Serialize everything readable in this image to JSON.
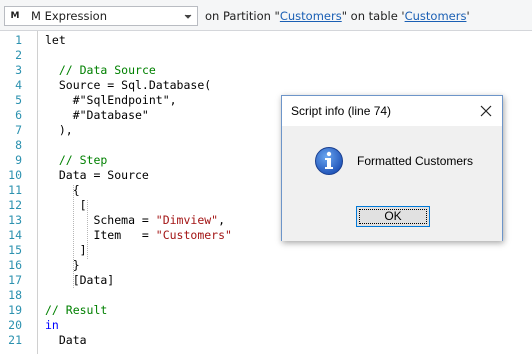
{
  "toolbar": {
    "expression_icon": "M",
    "expression_type": "M Expression",
    "partition_prefix": "on Partition \"",
    "partition_name": "Customers",
    "table_middle": "\" on table '",
    "table_name": "Customers",
    "table_suffix": "'"
  },
  "editor": {
    "lines": [
      {
        "n": "1",
        "parts": [
          [
            "",
            "let"
          ]
        ]
      },
      {
        "n": "2",
        "parts": []
      },
      {
        "n": "3",
        "parts": [
          [
            "",
            "  "
          ],
          [
            "cm",
            "// Data Source"
          ]
        ]
      },
      {
        "n": "4",
        "parts": [
          [
            "",
            "  Source = Sql.Database("
          ]
        ]
      },
      {
        "n": "5",
        "parts": [
          [
            "",
            "    #\"SqlEndpoint\","
          ]
        ]
      },
      {
        "n": "6",
        "parts": [
          [
            "",
            "    #\"Database\""
          ]
        ]
      },
      {
        "n": "7",
        "parts": [
          [
            "",
            "  ),"
          ]
        ]
      },
      {
        "n": "8",
        "parts": []
      },
      {
        "n": "9",
        "parts": [
          [
            "",
            "  "
          ],
          [
            "cm",
            "// Step"
          ]
        ]
      },
      {
        "n": "10",
        "parts": [
          [
            "",
            "  Data = Source"
          ]
        ]
      },
      {
        "n": "11",
        "parts": [
          [
            "",
            "    {"
          ]
        ]
      },
      {
        "n": "12",
        "parts": [
          [
            "",
            "     ["
          ]
        ]
      },
      {
        "n": "13",
        "parts": [
          [
            "",
            "       Schema = "
          ],
          [
            "st",
            "\"Dimview\""
          ],
          [
            "",
            ","
          ]
        ]
      },
      {
        "n": "14",
        "parts": [
          [
            "",
            "       Item   = "
          ],
          [
            "st",
            "\"Customers\""
          ]
        ]
      },
      {
        "n": "15",
        "parts": [
          [
            "",
            "     ]"
          ]
        ]
      },
      {
        "n": "16",
        "parts": [
          [
            "",
            "    }"
          ]
        ]
      },
      {
        "n": "17",
        "parts": [
          [
            "",
            "    [Data]"
          ]
        ]
      },
      {
        "n": "18",
        "parts": []
      },
      {
        "n": "19",
        "parts": [
          [
            "cm",
            "// Result"
          ]
        ]
      },
      {
        "n": "20",
        "parts": [
          [
            "kw",
            "in"
          ]
        ]
      },
      {
        "n": "21",
        "parts": [
          [
            "",
            "  Data"
          ]
        ]
      }
    ]
  },
  "dialog": {
    "title": "Script info (line 74)",
    "message": "Formatted Customers",
    "ok_label": "OK",
    "icon": "info-icon",
    "close_icon": "close-icon"
  },
  "colors": {
    "line_numbers": "#2b91af",
    "comment": "#008000",
    "string": "#a31515",
    "keyword": "#0000ff",
    "link": "#1a5fb4"
  }
}
